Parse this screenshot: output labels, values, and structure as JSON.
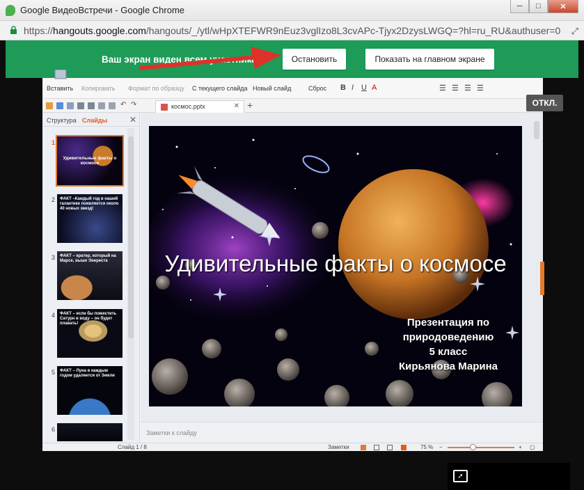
{
  "window": {
    "title": "Google ВидеоВстречи - Google Chrome",
    "url_scheme": "https://",
    "url_host": "hangouts.google.com",
    "url_path": "/hangouts/_/ytl/wHpXTEFWR9nEuz3vglIzo8L3cvAPc-Tjyx2DzysLWGQ=?hl=ru_RU&authuser=0"
  },
  "banner": {
    "text": "Ваш экран виден всем участникам",
    "stop_label": "Остановить",
    "show_main_label": "Показать на главном экране"
  },
  "ribbon": {
    "paste": "Вставить",
    "copy": "Копировать",
    "format_painter": "Формат по образцу",
    "from_current": "С текущего слайда",
    "new_slide": "Новый слайд",
    "reset": "Сброс",
    "bold": "B",
    "italic": "I",
    "underline": "U",
    "font_color": "A"
  },
  "doc_tab": {
    "name": "космос.pptx"
  },
  "otkl_label": "ОТКЛ.",
  "side_panel": {
    "tab_structure": "Структура",
    "tab_slides": "Слайды",
    "thumbs": [
      {
        "num": "1",
        "caption": "Удивительные факты о космосе",
        "sub": "Презентация по природоведению 5 класс Кирьянова Марина"
      },
      {
        "num": "2",
        "caption": "ФАКТ –Каждый год в нашей галактике появляется около 40 новых звезд!",
        "sub": ""
      },
      {
        "num": "3",
        "caption": "ФАКТ – кратер, который на Марсе, выше Эвереста",
        "sub": ""
      },
      {
        "num": "4",
        "caption": "ФАКТ – если бы поместить Сатурн в воду – он будет плавать!",
        "sub": ""
      },
      {
        "num": "5",
        "caption": "ФАКТ – Луна в каждым годом удаляется от Земли",
        "sub": ""
      },
      {
        "num": "6",
        "caption": "",
        "sub": ""
      }
    ]
  },
  "slide": {
    "title": "Удивительные факты о космосе",
    "subtitle_lines": [
      "Презентация по",
      "природоведению",
      "5 класс",
      "Кирьянова Марина"
    ]
  },
  "notes_placeholder": "Заметки к слайду",
  "status": {
    "slide_counter": "Слайд 1 / 8",
    "notes_label": "Заметки",
    "zoom": "75 %"
  },
  "colors": {
    "banner_green": "#1d9b57",
    "accent_orange": "#e55a1c",
    "arrow_red": "#e0302a"
  }
}
